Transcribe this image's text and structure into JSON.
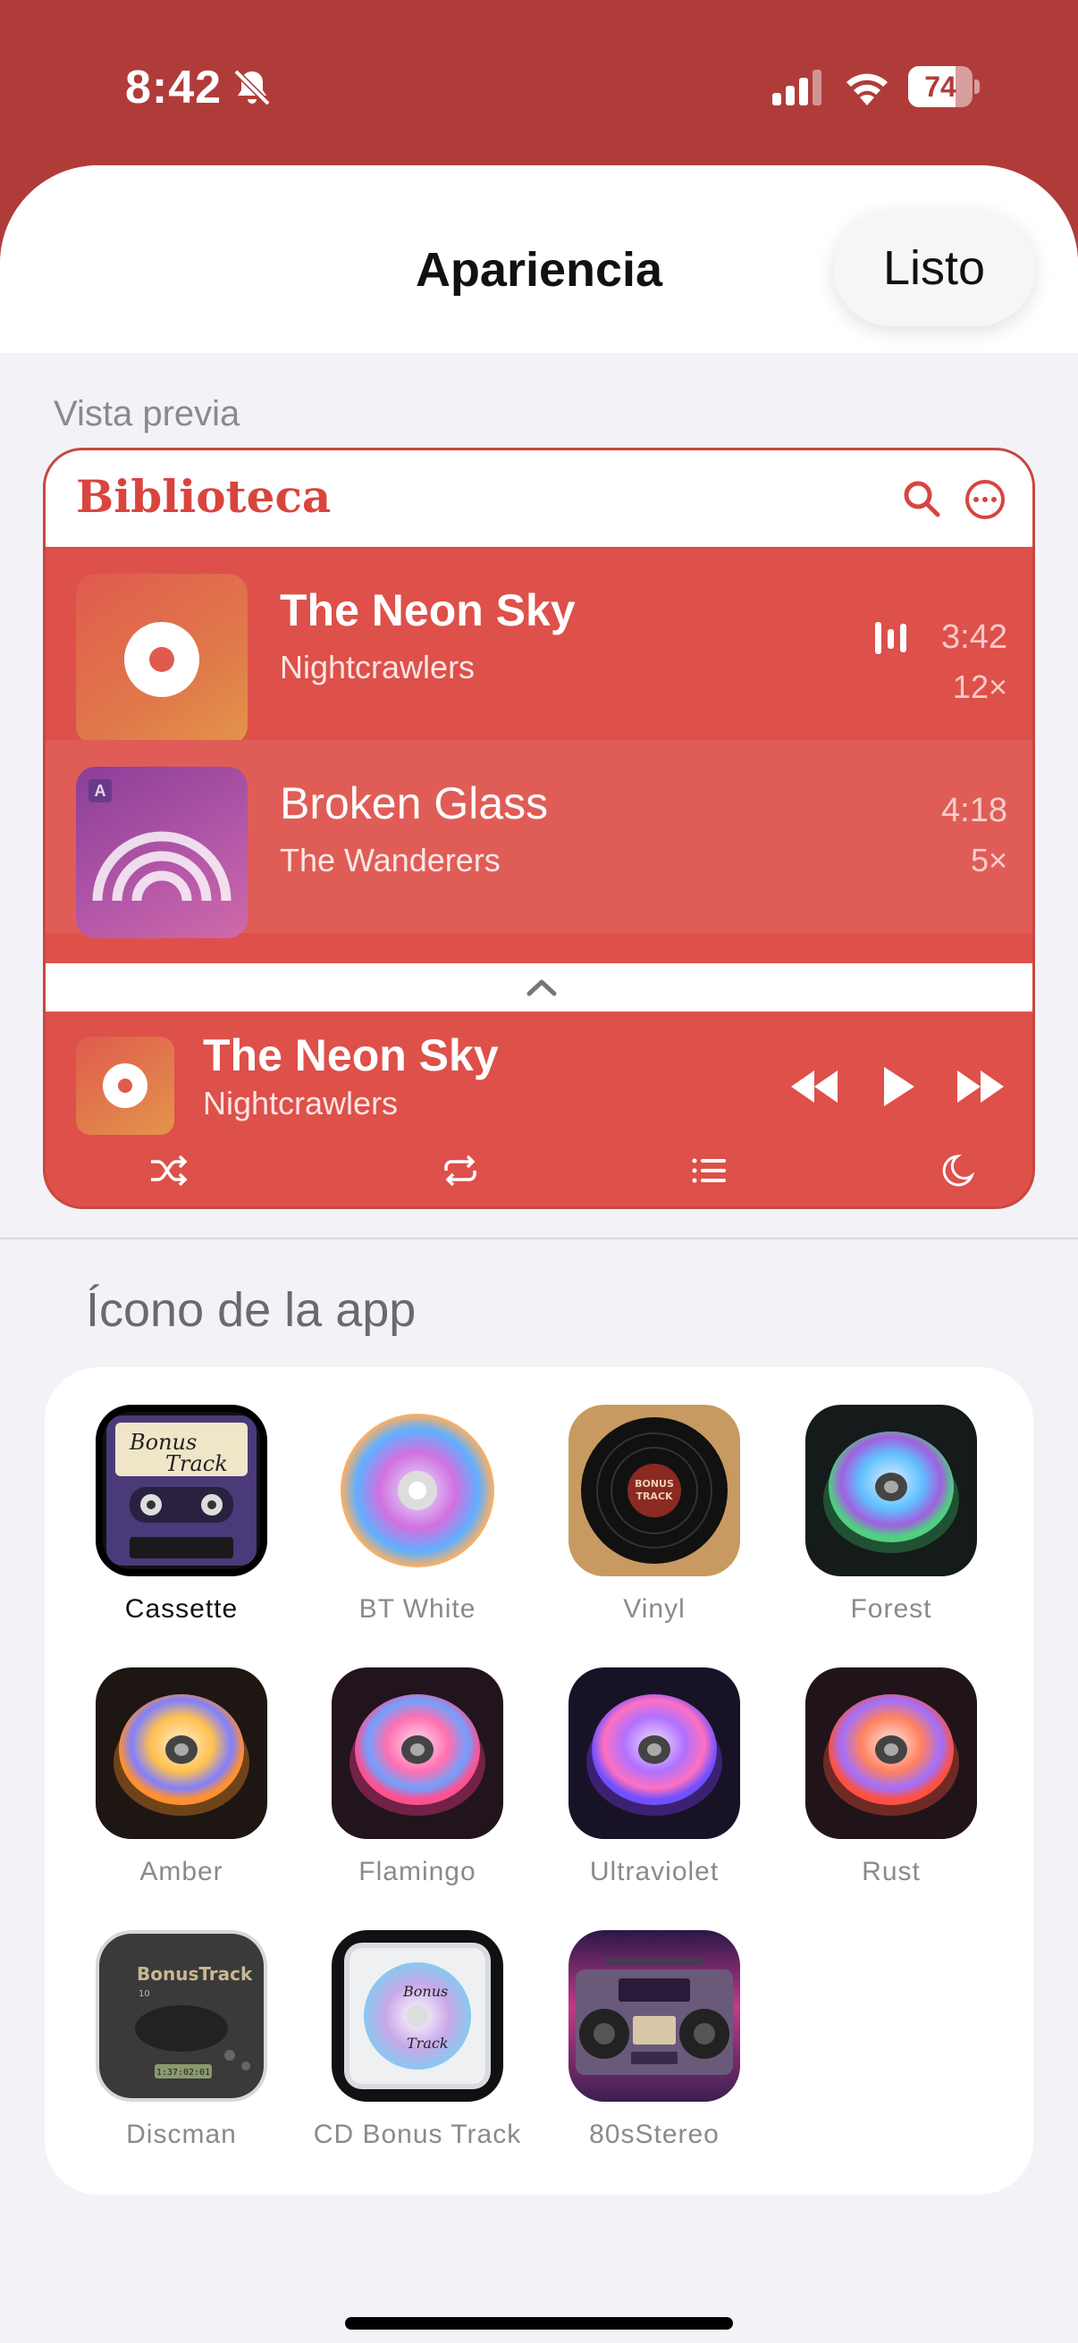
{
  "status_bar": {
    "time": "8:42",
    "battery": "74"
  },
  "sheet": {
    "title": "Apariencia",
    "done_label": "Listo"
  },
  "preview": {
    "section_label": "Vista previa",
    "header_title": "Biblioteca",
    "tracks": [
      {
        "title": "The Neon Sky",
        "artist": "Nightcrawlers",
        "duration": "3:42",
        "plays": "12×"
      },
      {
        "title": "Broken Glass",
        "artist": "The Wanderers",
        "duration": "4:18",
        "plays": "5×"
      }
    ],
    "now_playing": {
      "title": "The Neon Sky",
      "artist": "Nightcrawlers"
    }
  },
  "app_icons": {
    "section_label": "Ícono de la app",
    "items": [
      {
        "label": "Cassette",
        "selected": true
      },
      {
        "label": "BT White"
      },
      {
        "label": "Vinyl"
      },
      {
        "label": "Forest"
      },
      {
        "label": "Amber"
      },
      {
        "label": "Flamingo"
      },
      {
        "label": "Ultraviolet"
      },
      {
        "label": "Rust"
      },
      {
        "label": "Discman"
      },
      {
        "label": "CD Bonus Track"
      },
      {
        "label": "80sStereo"
      }
    ],
    "art_text": {
      "cassette": [
        "Bonus",
        "Track"
      ],
      "vinyl": [
        "BONUS",
        "TRACK"
      ],
      "discman": [
        "BonusTrack",
        "10",
        "1:37:02:01"
      ],
      "cd": [
        "Bonus",
        "Track"
      ]
    }
  },
  "colors": {
    "accent": "#de504a",
    "status_bg": "#b03c3a"
  }
}
